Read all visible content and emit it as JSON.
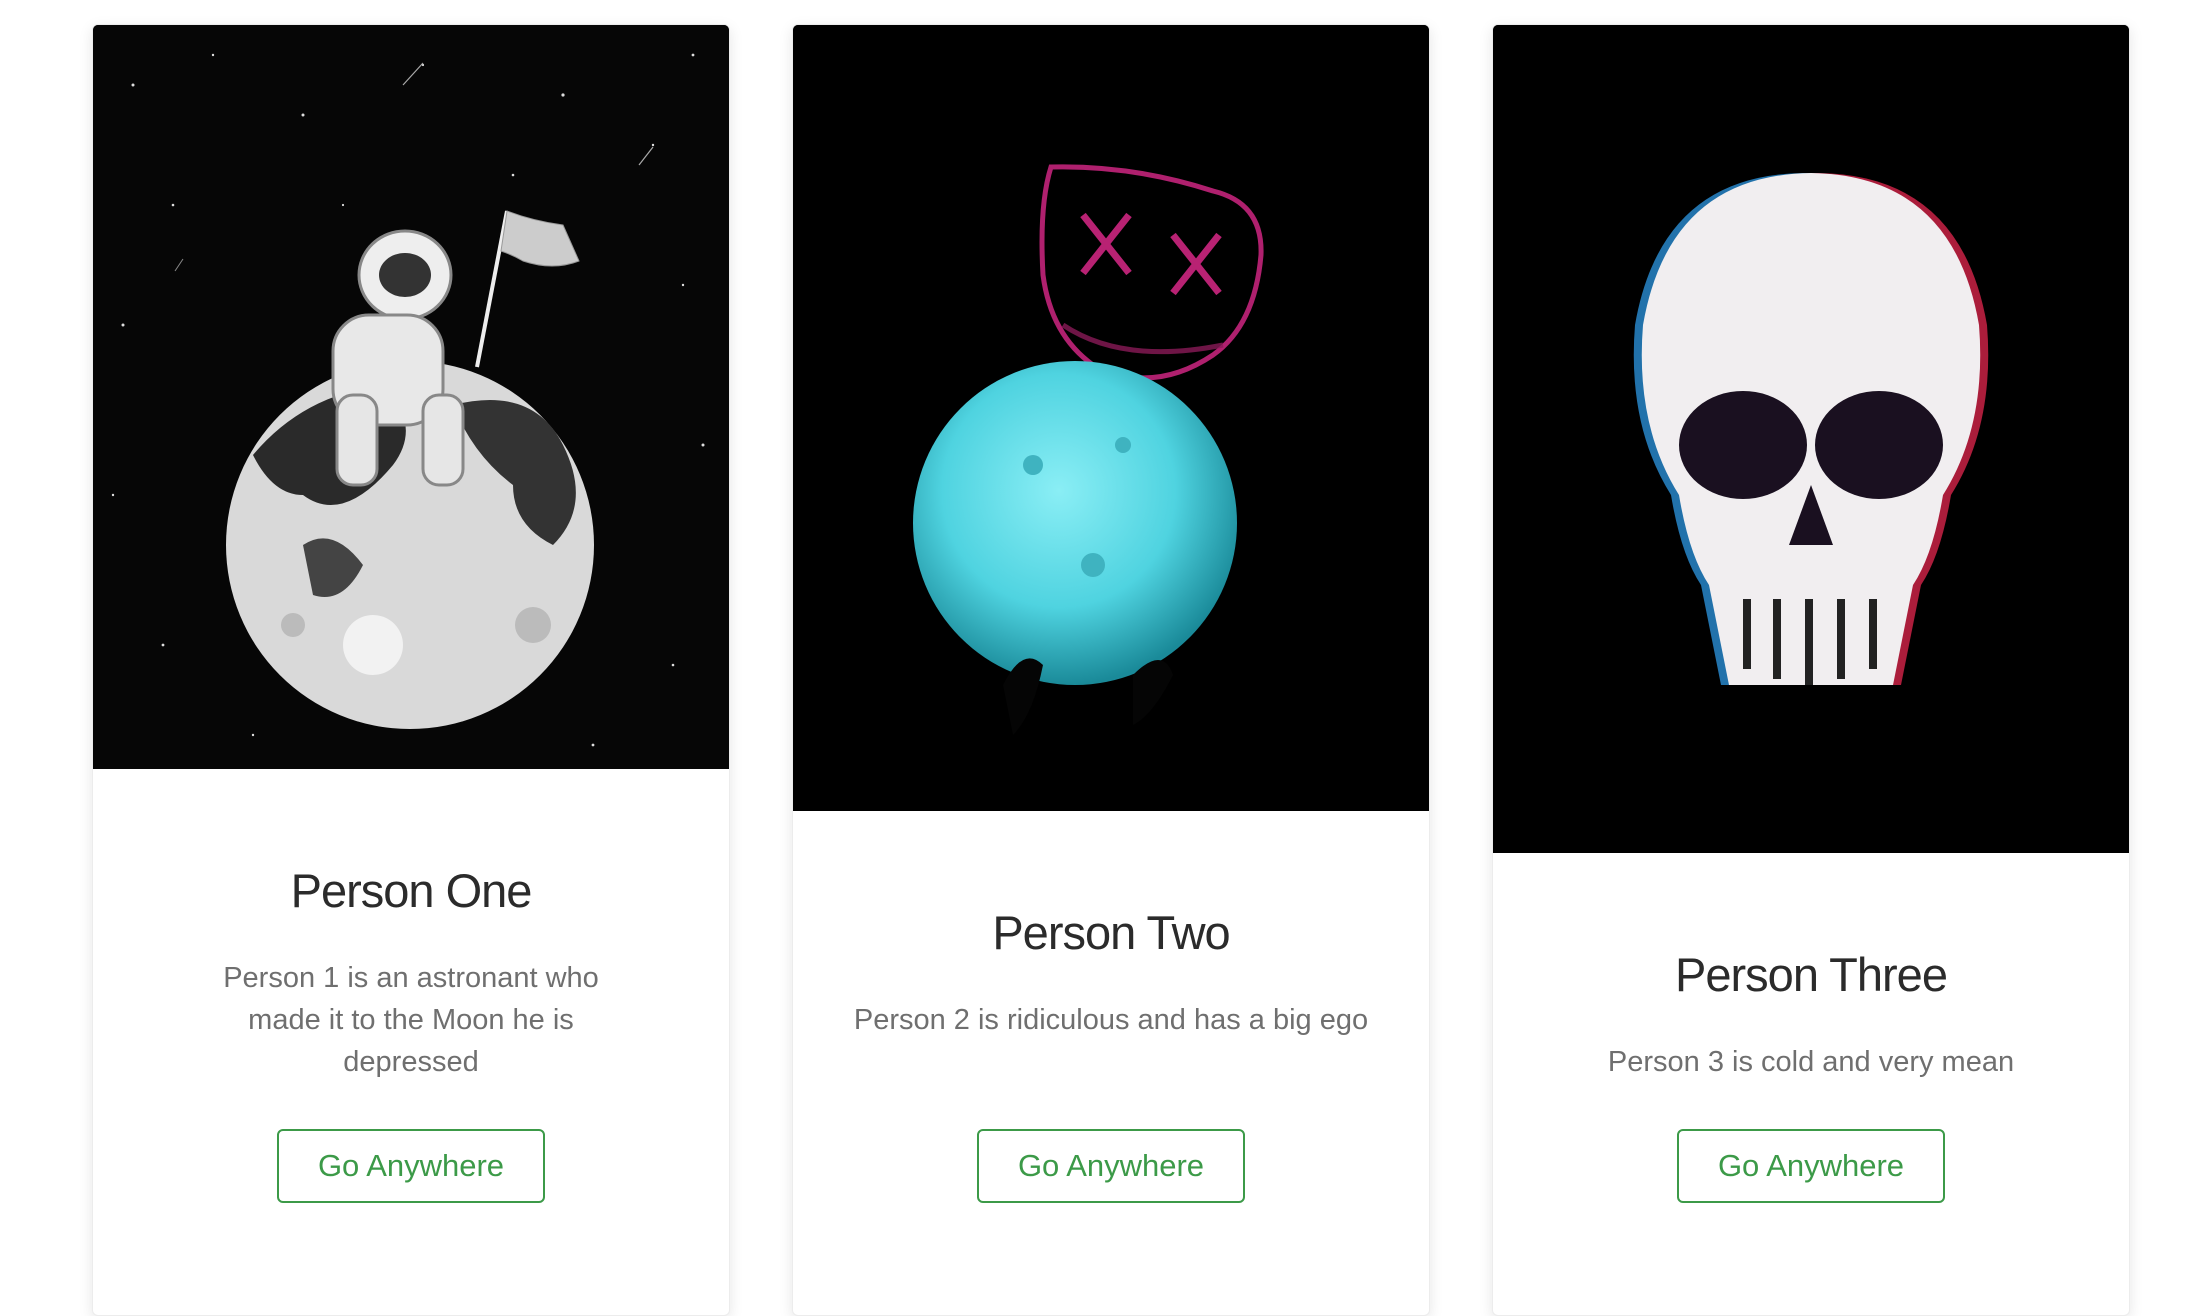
{
  "cards": [
    {
      "image_alt": "astronaut-on-moon-illustration",
      "title": "Person One",
      "text": "Person 1 is an astronant who made it to the Moon he is depressed",
      "button_label": "Go Anywhere"
    },
    {
      "image_alt": "glowing-moon-and-neon-mask",
      "title": "Person Two",
      "text": "Person 2 is ridiculous and has a big ego",
      "button_label": "Go Anywhere"
    },
    {
      "image_alt": "glitch-skull",
      "title": "Person Three",
      "text": "Person 3 is cold and very mean",
      "button_label": "Go Anywhere"
    }
  ],
  "colors": {
    "button_accent": "#3c9a48",
    "title_text": "#2b2b2b",
    "body_text": "#6f6f6f",
    "moon_cyan": "#4fd3e0",
    "mask_pink": "#c2247a"
  }
}
